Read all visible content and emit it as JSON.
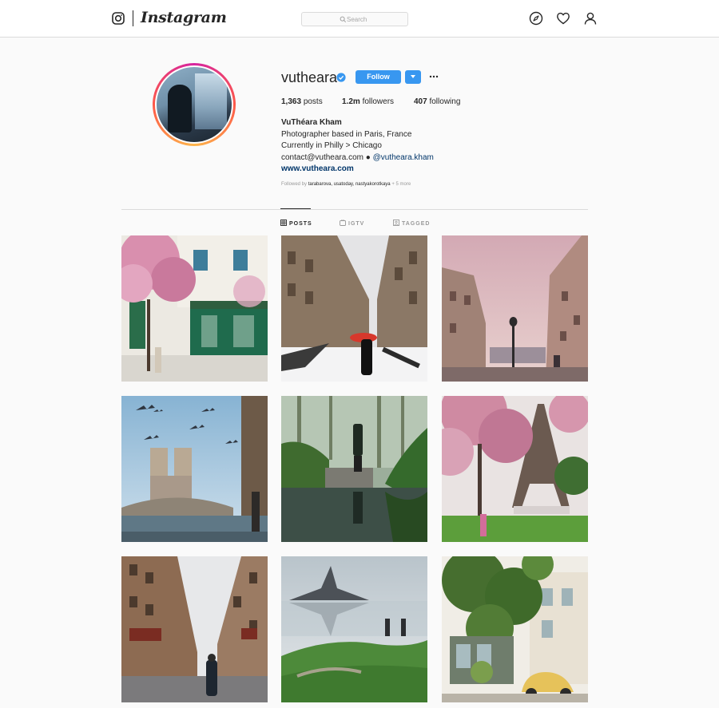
{
  "header": {
    "brand": "Instagram",
    "search_placeholder": "Search",
    "icons": [
      "instagram-glyph-icon",
      "search-icon",
      "compass-icon",
      "heart-icon",
      "user-icon"
    ]
  },
  "profile": {
    "username": "vutheara",
    "verified": true,
    "follow_label": "Follow",
    "stats": {
      "posts_count": "1,363",
      "posts_label": "posts",
      "followers_count": "1.2m",
      "followers_label": "followers",
      "following_count": "407",
      "following_label": "following"
    },
    "full_name": "VuThéara Kham",
    "bio_lines": [
      "Photographer based in Paris, France",
      "Currently in Philly > Chicago",
      "contact@vutheara.com ● "
    ],
    "bio_mention": "@vutheara.kham",
    "website": "www.vutheara.com",
    "followed_by_prefix": "Followed by",
    "followed_by_names": "tarabarova, usatoday, nastyakorotkaya",
    "followed_by_more": "+ 5 more"
  },
  "tabs": [
    {
      "label": "POSTS",
      "active": true
    },
    {
      "label": "IGTV",
      "active": false
    },
    {
      "label": "TAGGED",
      "active": false
    }
  ],
  "colors": {
    "accent": "#3897f0",
    "link": "#003569",
    "ring_start": "#d6249f",
    "ring_end": "#fdb54a"
  }
}
